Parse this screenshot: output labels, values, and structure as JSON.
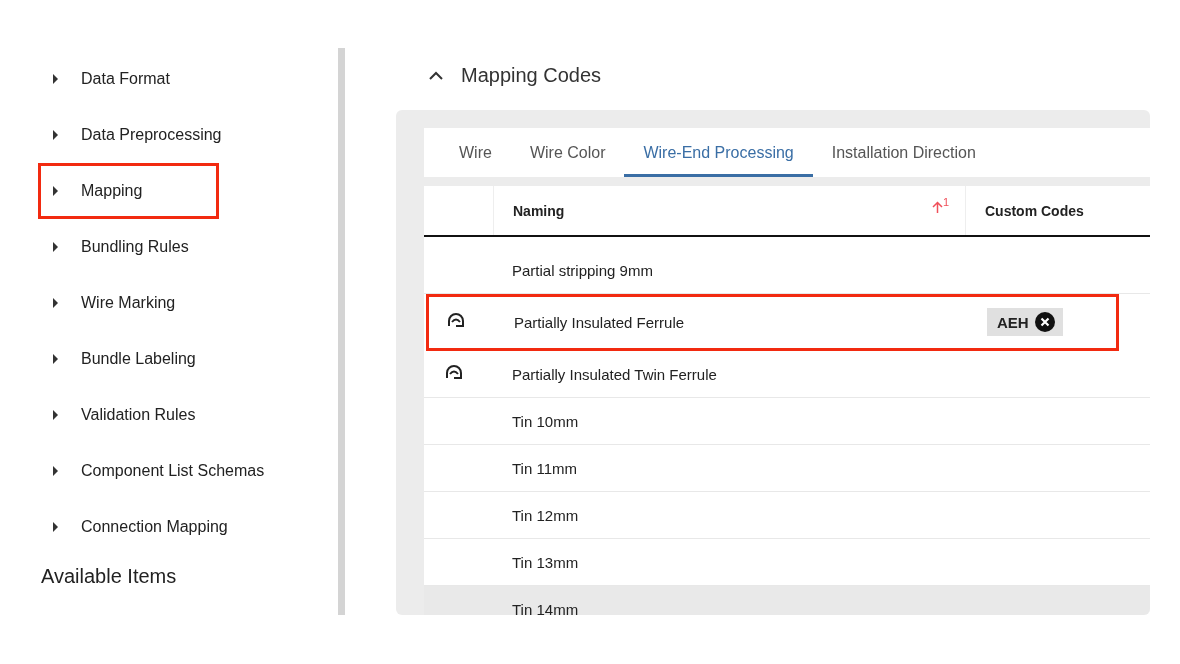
{
  "sidebar": {
    "items": [
      {
        "label": "Data Format",
        "highlighted": false
      },
      {
        "label": "Data Preprocessing",
        "highlighted": false
      },
      {
        "label": "Mapping",
        "highlighted": true
      },
      {
        "label": "Bundling Rules",
        "highlighted": false
      },
      {
        "label": "Wire Marking",
        "highlighted": false
      },
      {
        "label": "Bundle Labeling",
        "highlighted": false
      },
      {
        "label": "Validation Rules",
        "highlighted": false
      },
      {
        "label": "Component List Schemas",
        "highlighted": false
      },
      {
        "label": "Connection Mapping",
        "highlighted": false
      }
    ],
    "section_title": "Available Items"
  },
  "section": {
    "title": "Mapping Codes",
    "expanded": true,
    "tabs": [
      {
        "label": "Wire",
        "selected": false
      },
      {
        "label": "Wire Color",
        "selected": false
      },
      {
        "label": "Wire-End Processing",
        "selected": true
      },
      {
        "label": "Installation Direction",
        "selected": false
      }
    ],
    "table": {
      "columns": [
        {
          "label": "Naming",
          "sort_order": "1"
        },
        {
          "label": "Custom Codes"
        }
      ],
      "rows": [
        {
          "naming": "Partial stripping 9mm",
          "icon": false,
          "highlighted": false,
          "hovered": false
        },
        {
          "naming": "Partially Insulated Ferrule",
          "icon": true,
          "highlighted": true,
          "hovered": false,
          "custom_codes": [
            "AEH"
          ]
        },
        {
          "naming": "Partially Insulated Twin Ferrule",
          "icon": true,
          "highlighted": false,
          "hovered": false
        },
        {
          "naming": "Tin 10mm",
          "icon": false,
          "highlighted": false,
          "hovered": false
        },
        {
          "naming": "Tin 11mm",
          "icon": false,
          "highlighted": false,
          "hovered": false
        },
        {
          "naming": "Tin 12mm",
          "icon": false,
          "highlighted": false,
          "hovered": false
        },
        {
          "naming": "Tin 13mm",
          "icon": false,
          "highlighted": false,
          "hovered": false
        },
        {
          "naming": "Tin 14mm",
          "icon": false,
          "highlighted": false,
          "hovered": true
        }
      ]
    }
  }
}
